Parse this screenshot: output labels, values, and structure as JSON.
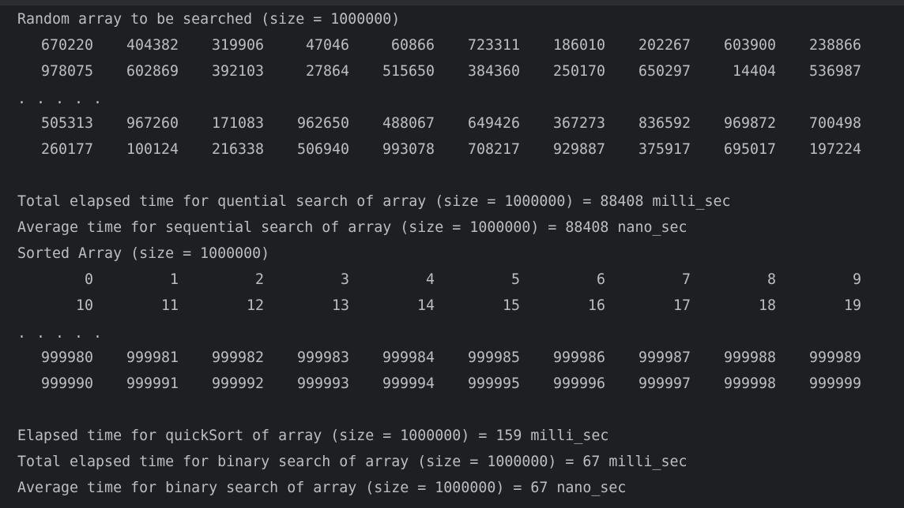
{
  "output": {
    "random_header": "Random array to be searched (size = 1000000)",
    "random_top_rows": [
      [
        "670220",
        "404382",
        "319906",
        "47046",
        "60866",
        "723311",
        "186010",
        "202267",
        "603900",
        "238866"
      ],
      [
        "978075",
        "602869",
        "392103",
        "27864",
        "515650",
        "384360",
        "250170",
        "650297",
        "14404",
        "536987"
      ]
    ],
    "random_ellipsis": ". . . . .",
    "random_bottom_rows": [
      [
        "505313",
        "967260",
        "171083",
        "962650",
        "488067",
        "649426",
        "367273",
        "836592",
        "969872",
        "700498"
      ],
      [
        "260177",
        "100124",
        "216338",
        "506940",
        "993078",
        "708217",
        "929887",
        "375917",
        "695017",
        "197224"
      ]
    ],
    "sequential_total": "Total elapsed time for quential search of array (size = 1000000) = 88408 milli_sec",
    "sequential_average": "Average time for sequential search of array (size = 1000000) = 88408 nano_sec",
    "sorted_header": "Sorted Array (size = 1000000)",
    "sorted_top_rows": [
      [
        "0",
        "1",
        "2",
        "3",
        "4",
        "5",
        "6",
        "7",
        "8",
        "9"
      ],
      [
        "10",
        "11",
        "12",
        "13",
        "14",
        "15",
        "16",
        "17",
        "18",
        "19"
      ]
    ],
    "sorted_ellipsis": ". . . . .",
    "sorted_bottom_rows": [
      [
        "999980",
        "999981",
        "999982",
        "999983",
        "999984",
        "999985",
        "999986",
        "999987",
        "999988",
        "999989"
      ],
      [
        "999990",
        "999991",
        "999992",
        "999993",
        "999994",
        "999995",
        "999996",
        "999997",
        "999998",
        "999999"
      ]
    ],
    "quicksort_time": "Elapsed time for quickSort of array (size = 1000000) = 159 milli_sec",
    "binary_total": "Total elapsed time for binary search of array (size = 1000000) = 67 milli_sec",
    "binary_average": "Average time for binary search of array (size = 1000000) = 67 nano_sec"
  }
}
